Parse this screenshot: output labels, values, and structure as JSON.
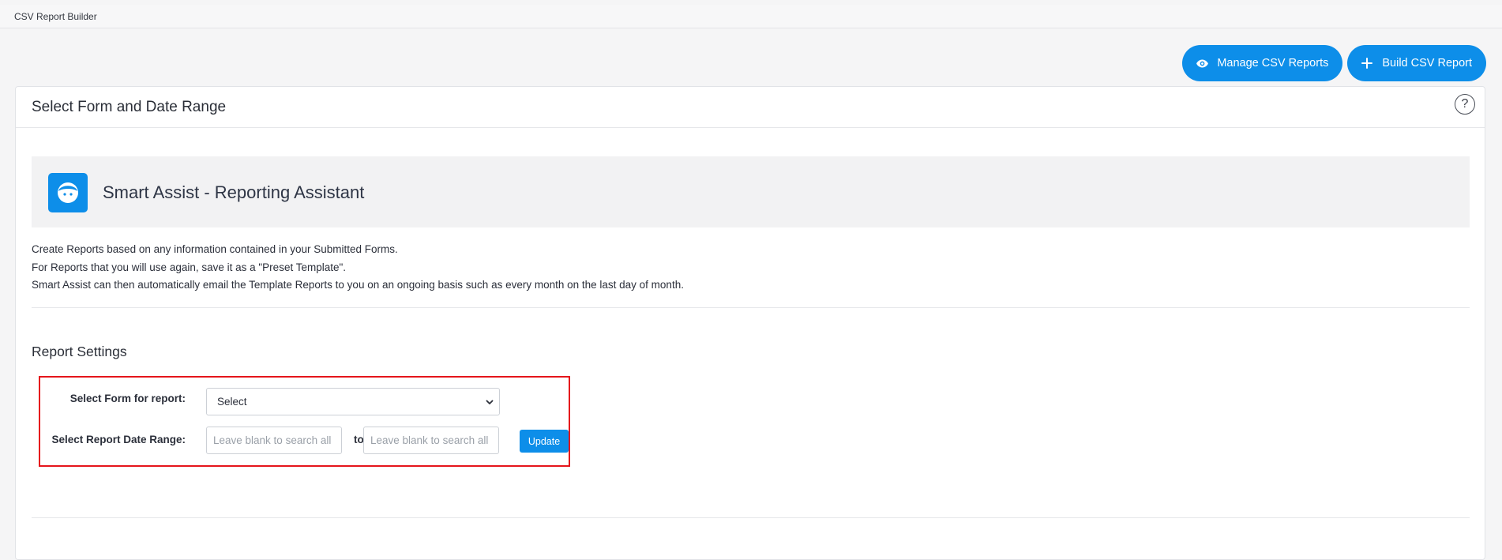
{
  "breadcrumb": "CSV Report Builder",
  "actions": {
    "manage_label": "Manage CSV Reports",
    "build_label": "Build CSV Report"
  },
  "card": {
    "title": "Select Form and Date Range",
    "help_symbol": "?"
  },
  "assistant": {
    "title": "Smart Assist - Reporting Assistant",
    "intro_lines": [
      "Create Reports based on any information contained in your Submitted Forms.",
      "For Reports that you will use again, save it as a \"Preset Template\".",
      "Smart Assist can then automatically email the Template Reports to you on an ongoing basis such as every month on the last day of month."
    ]
  },
  "report_settings": {
    "title": "Report Settings",
    "form_label": "Select Form for report:",
    "form_selected": "Select",
    "date_label": "Select Report Date Range:",
    "date_from_placeholder": "Leave blank to search all",
    "date_to_placeholder": "Leave blank to search all",
    "to_label": "to",
    "update_label": "Update"
  },
  "colors": {
    "accent": "#0d8ee9",
    "highlight_border": "#e5151b"
  }
}
